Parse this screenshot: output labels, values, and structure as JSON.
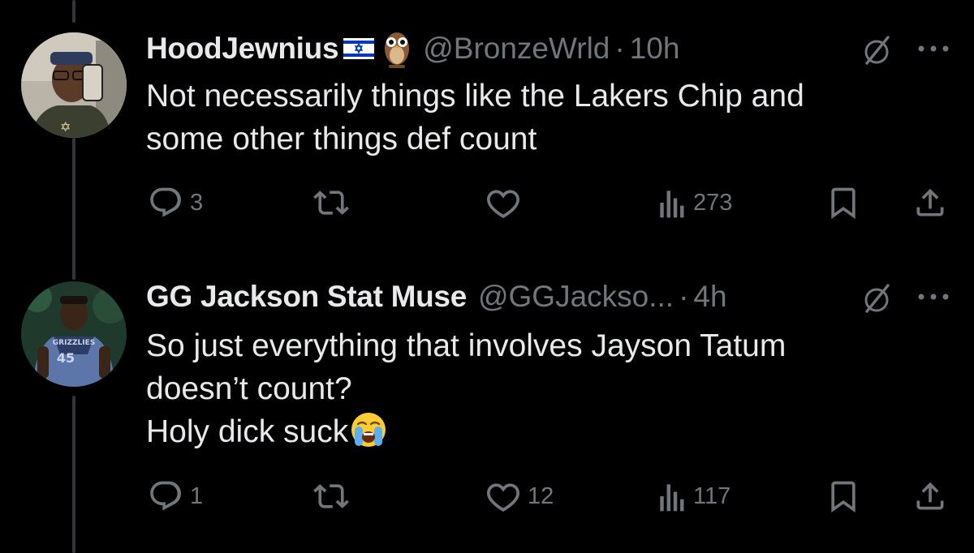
{
  "tweets": [
    {
      "display_name": "HoodJewnius",
      "name_emojis": [
        "israel-flag",
        "owl"
      ],
      "handle": "@BronzeWrld",
      "separator": "·",
      "time": "10h",
      "lines": [
        "Not necessarily things like the Lakers Chip and",
        "some other things def count"
      ],
      "replies": "3",
      "reposts": "",
      "likes": "",
      "views": "273"
    },
    {
      "display_name": "GG Jackson Stat Muse",
      "handle": "@GGJackso...",
      "separator": "·",
      "time": "4h",
      "lines": [
        "So just everything that involves Jayson Tatum",
        "doesn’t count?",
        "Holy dick suck"
      ],
      "trailing_emoji": "loudly-crying-face",
      "avatar_jersey": {
        "team": "GRIZZLIES",
        "number": "45"
      },
      "replies": "1",
      "reposts": "",
      "likes": "12",
      "views": "117"
    }
  ],
  "colors": {
    "background": "#000000",
    "text": "#e7e9ea",
    "muted": "#71767b",
    "thread_line": "#333639"
  }
}
